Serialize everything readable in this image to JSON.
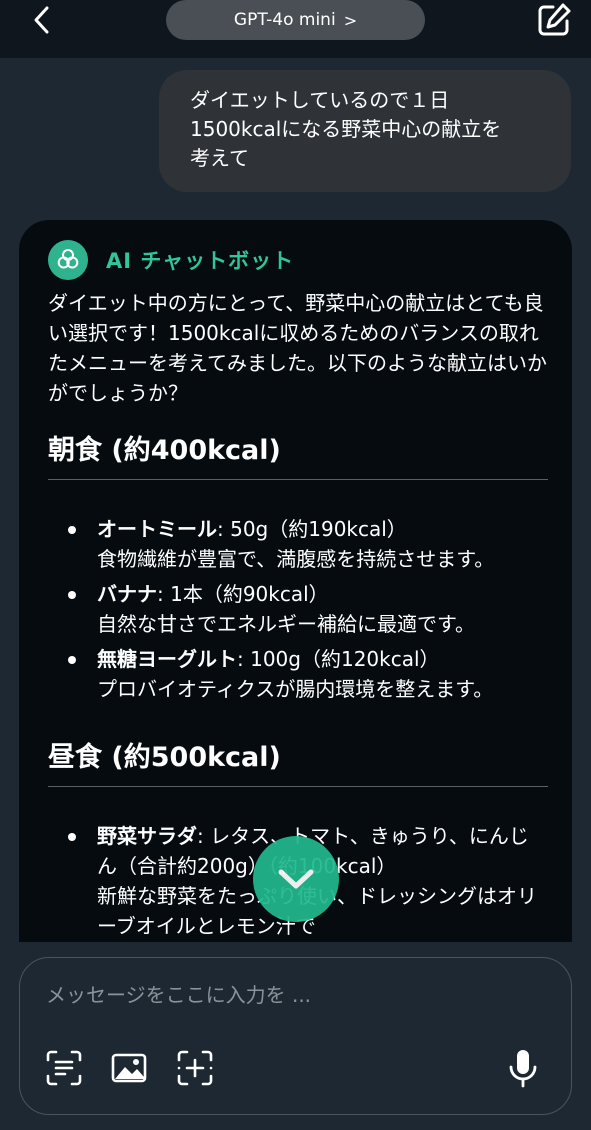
{
  "header": {
    "model_label": "GPT-4o mini",
    "model_chevron": ">",
    "back_icon": "chevron-left-icon",
    "new_chat_icon": "edit-icon"
  },
  "user_message": "ダイエットしているので１日\n1500kcalになる野菜中心の献立を\n考えて",
  "ai_message": {
    "bot_name": "AI チャットボット",
    "intro": "ダイエット中の方にとって、野菜中心の献立はとても良い選択です！1500kcalに収めるためのバランスの取れたメニューを考えてみました。以下のような献立はいかがでしょうか？",
    "sections": [
      {
        "title": "朝食 (約400kcal)",
        "items": [
          {
            "name": "オートミール",
            "amount": ": 50g（約190kcal）",
            "desc": "食物繊維が豊富で、満腹感を持続させます。"
          },
          {
            "name": "バナナ",
            "amount": ": 1本（約90kcal）",
            "desc": "自然な甘さでエネルギー補給に最適です。"
          },
          {
            "name": "無糖ヨーグルト",
            "amount": ": 100g（約120kcal）",
            "desc": "プロバイオティクスが腸内環境を整えます。"
          }
        ]
      },
      {
        "title": "昼食 (約500kcal)",
        "items": [
          {
            "name": "野菜サラダ",
            "amount": ": レタス、トマト、きゅうり、にんじん（合計約200g）（約100kcal）",
            "desc": "新鮮な野菜をたっぷり使い、ドレッシングはオリーブオイルとレモン汁で"
          }
        ]
      }
    ]
  },
  "input": {
    "placeholder": "メッセージをここに入力を ..."
  },
  "colors": {
    "background": "#1e2833",
    "topbar": "#10161d",
    "user_bubble": "#2f3338",
    "ai_card": "#060b10",
    "accent": "#2fb38e"
  }
}
